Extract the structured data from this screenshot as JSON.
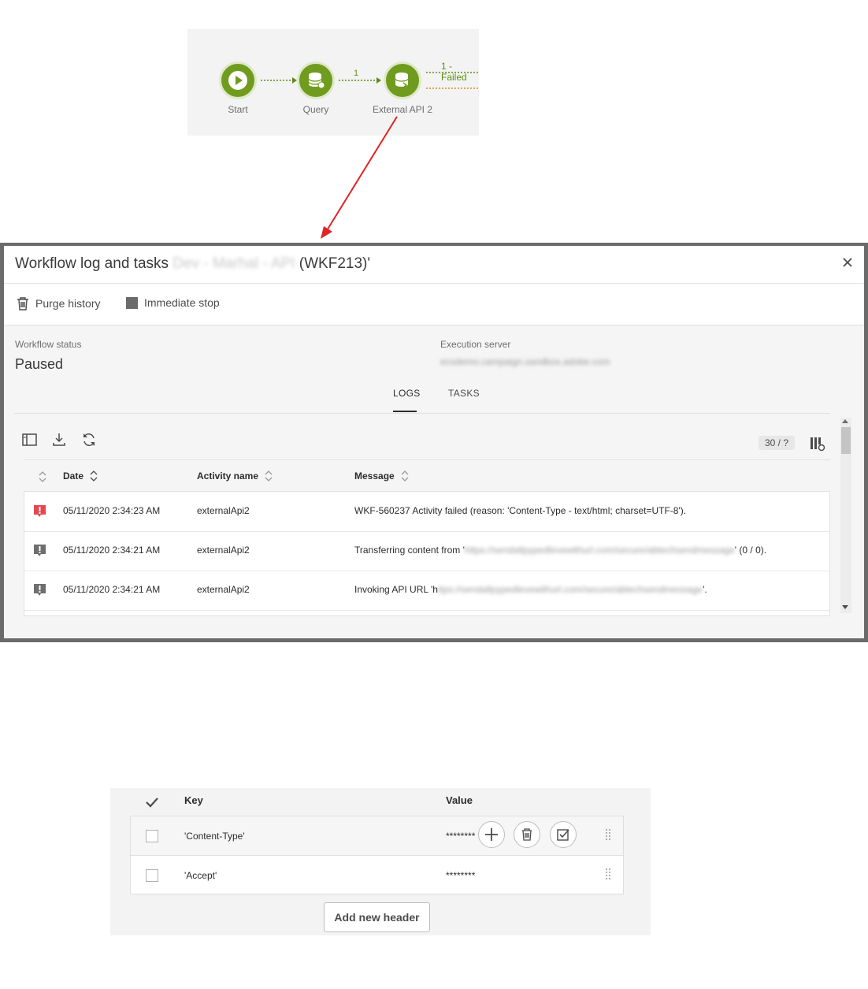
{
  "workflow": {
    "nodes": [
      {
        "label": "Start"
      },
      {
        "label": "Query"
      },
      {
        "label": "External API 2"
      }
    ],
    "edge_count_label": "1",
    "failed_label": "1 - Failed",
    "colors": {
      "node": "#6f9c1e",
      "edge": "#5d8f12",
      "error_edge": "#d98b1c",
      "arrow": "#e02424"
    }
  },
  "dialog": {
    "title_prefix": "Workflow log and tasks",
    "title_redacted": "Dev - Marhal - API",
    "title_suffix": "(WKF213)'",
    "toolbar": {
      "purge_label": "Purge history",
      "stop_label": "Immediate stop"
    },
    "status": {
      "label": "Workflow status",
      "value": "Paused"
    },
    "server": {
      "label": "Execution server",
      "value_redacted": "ecsdemo.campaign.sandbox.adobe.com"
    },
    "tabs": [
      {
        "label": "LOGS",
        "active": true
      },
      {
        "label": "TASKS",
        "active": false
      }
    ],
    "paging": "30 / ?",
    "columns": {
      "date": "Date",
      "activity": "Activity name",
      "message": "Message"
    },
    "rows": [
      {
        "severity": "error",
        "date": "05/11/2020 2:34:23 AM",
        "activity": "externalApi2",
        "message": "WKF-560237 Activity failed (reason: 'Content-Type - text/html; charset=UTF-8').",
        "message_redacted": "",
        "message_tail": ""
      },
      {
        "severity": "info",
        "date": "05/11/2020 2:34:21 AM",
        "activity": "externalApi2",
        "message": "Transferring content from '",
        "message_redacted": "https://sendallpypedlevewithurl.com/secure/abtechsendmessage",
        "message_tail": "' (0 / 0)."
      },
      {
        "severity": "info",
        "date": "05/11/2020 2:34:21 AM",
        "activity": "externalApi2",
        "message": "Invoking API URL 'h",
        "message_redacted": "ttps://sendallpypedlevewithurl.com/secure/abtechsendmessage",
        "message_tail": "'."
      }
    ],
    "colors": {
      "error": "#e34850",
      "info": "#6e6e6e"
    }
  },
  "headers_panel": {
    "columns": {
      "key": "Key",
      "value": "Value"
    },
    "rows": [
      {
        "key": "'Content-Type'",
        "value": "********"
      },
      {
        "key": "'Accept'",
        "value": "********"
      }
    ],
    "add_button_label": "Add new header"
  }
}
